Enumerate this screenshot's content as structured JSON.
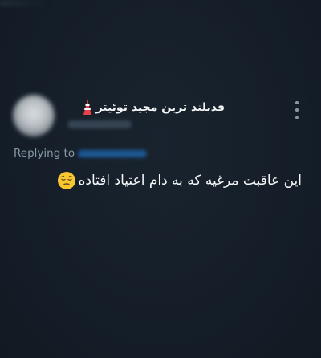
{
  "tweet": {
    "display_name": "قدبلند ترین مجید توئیتر",
    "name_emoji": "tower-emoji",
    "replying_label": "Replying to",
    "text": "این عاقبت مرغیه که به دام اعتیاد افتاده",
    "text_emoji": "pensive-face-emoji"
  },
  "colors": {
    "background": "#15202b",
    "secondary_text": "#8899a6",
    "link": "#1d9bf0",
    "primary_text": "#ffffff"
  },
  "icons": {
    "more": "more-vertical-icon"
  }
}
